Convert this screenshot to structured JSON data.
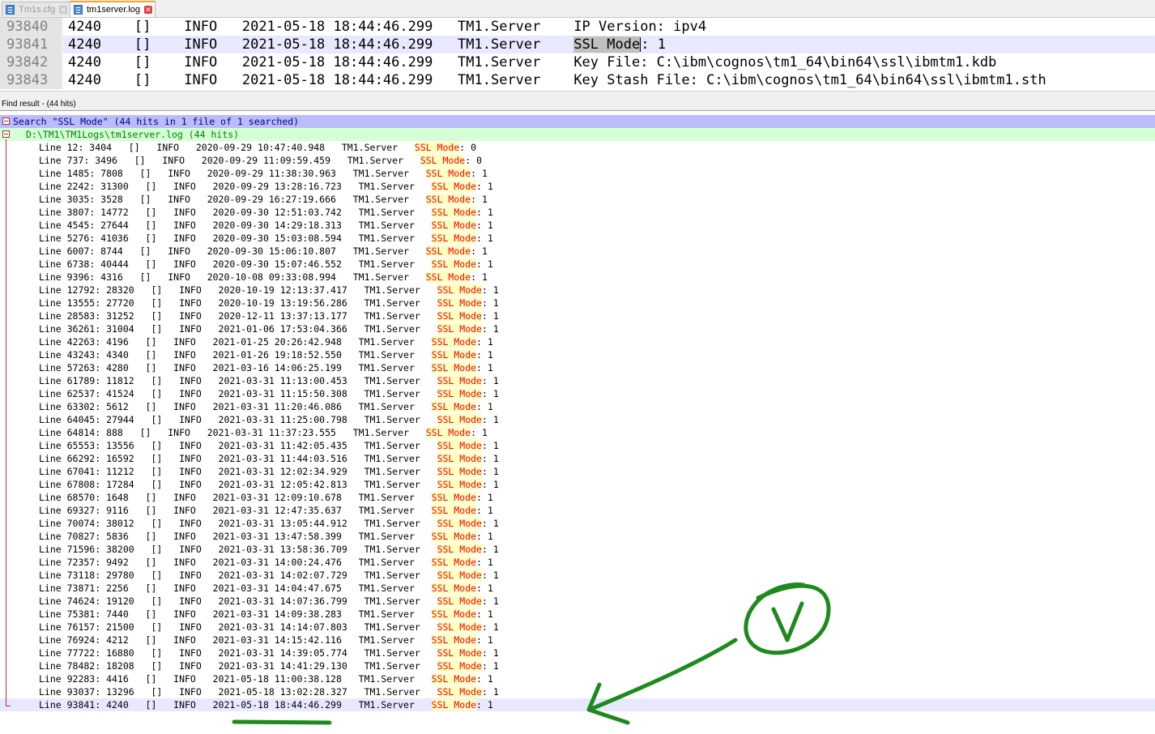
{
  "tabs": [
    {
      "label": "Tm1s.cfg",
      "active": false,
      "icon": "document-icon"
    },
    {
      "label": "tm1server.log",
      "active": true,
      "icon": "document-icon"
    }
  ],
  "editor": {
    "lines": [
      {
        "num": "93840",
        "pre": "4240    []    INFO   2021-05-18 18:44:46.299   TM1.Server    IP Version: ipv4",
        "match": "",
        "post": ""
      },
      {
        "num": "93841",
        "pre": "4240    []    INFO   2021-05-18 18:44:46.299   TM1.Server    ",
        "match": "SSL Mode",
        "post": ": 1"
      },
      {
        "num": "93842",
        "pre": "4240    []    INFO   2021-05-18 18:44:46.299   TM1.Server    Key File: C:\\ibm\\cognos\\tm1_64\\bin64\\ssl\\ibmtm1.kdb",
        "match": "",
        "post": ""
      },
      {
        "num": "93843",
        "pre": "4240    []    INFO   2021-05-18 18:44:46.299   TM1.Server    Key Stash File: C:\\ibm\\cognos\\tm1_64\\bin64\\ssl\\ibmtm1.sth",
        "match": "",
        "post": ""
      }
    ]
  },
  "find_panel": {
    "title": "Find result - (44 hits)",
    "search_header": "Search \"SSL Mode\" (44 hits in 1 file of 1 searched)",
    "file_header": "D:\\TM1\\TM1Logs\\tm1server.log (44 hits)",
    "results": [
      {
        "pre": "Line 12: 3404   []   INFO   2020-09-29 10:47:40.948   TM1.Server   ",
        "value": "0"
      },
      {
        "pre": "Line 737: 3496   []   INFO   2020-09-29 11:09:59.459   TM1.Server   ",
        "value": "0"
      },
      {
        "pre": "Line 1485: 7808   []   INFO   2020-09-29 11:38:30.963   TM1.Server   ",
        "value": "1"
      },
      {
        "pre": "Line 2242: 31300   []   INFO   2020-09-29 13:28:16.723   TM1.Server   ",
        "value": "1"
      },
      {
        "pre": "Line 3035: 3528   []   INFO   2020-09-29 16:27:19.666   TM1.Server   ",
        "value": "1"
      },
      {
        "pre": "Line 3807: 14772   []   INFO   2020-09-30 12:51:03.742   TM1.Server   ",
        "value": "1"
      },
      {
        "pre": "Line 4545: 27644   []   INFO   2020-09-30 14:29:18.313   TM1.Server   ",
        "value": "1"
      },
      {
        "pre": "Line 5276: 41036   []   INFO   2020-09-30 15:03:08.594   TM1.Server   ",
        "value": "1"
      },
      {
        "pre": "Line 6007: 8744   []   INFO   2020-09-30 15:06:10.807   TM1.Server   ",
        "value": "1"
      },
      {
        "pre": "Line 6738: 40444   []   INFO   2020-09-30 15:07:46.552   TM1.Server   ",
        "value": "1"
      },
      {
        "pre": "Line 9396: 4316   []   INFO   2020-10-08 09:33:08.994   TM1.Server   ",
        "value": "1"
      },
      {
        "pre": "Line 12792: 28320   []   INFO   2020-10-19 12:13:37.417   TM1.Server   ",
        "value": "1"
      },
      {
        "pre": "Line 13555: 27720   []   INFO   2020-10-19 13:19:56.286   TM1.Server   ",
        "value": "1"
      },
      {
        "pre": "Line 28583: 31252   []   INFO   2020-12-11 13:37:13.177   TM1.Server   ",
        "value": "1"
      },
      {
        "pre": "Line 36261: 31004   []   INFO   2021-01-06 17:53:04.366   TM1.Server   ",
        "value": "1"
      },
      {
        "pre": "Line 42263: 4196   []   INFO   2021-01-25 20:26:42.948   TM1.Server   ",
        "value": "1"
      },
      {
        "pre": "Line 43243: 4340   []   INFO   2021-01-26 19:18:52.550   TM1.Server   ",
        "value": "1"
      },
      {
        "pre": "Line 57263: 4280   []   INFO   2021-03-16 14:06:25.199   TM1.Server   ",
        "value": "1"
      },
      {
        "pre": "Line 61789: 11812   []   INFO   2021-03-31 11:13:00.453   TM1.Server   ",
        "value": "1"
      },
      {
        "pre": "Line 62537: 41524   []   INFO   2021-03-31 11:15:50.308   TM1.Server   ",
        "value": "1"
      },
      {
        "pre": "Line 63302: 5612   []   INFO   2021-03-31 11:20:46.086   TM1.Server   ",
        "value": "1"
      },
      {
        "pre": "Line 64045: 27944   []   INFO   2021-03-31 11:25:00.798   TM1.Server   ",
        "value": "1"
      },
      {
        "pre": "Line 64814: 888   []   INFO   2021-03-31 11:37:23.555   TM1.Server   ",
        "value": "1"
      },
      {
        "pre": "Line 65553: 13556   []   INFO   2021-03-31 11:42:05.435   TM1.Server   ",
        "value": "1"
      },
      {
        "pre": "Line 66292: 16592   []   INFO   2021-03-31 11:44:03.516   TM1.Server   ",
        "value": "1"
      },
      {
        "pre": "Line 67041: 11212   []   INFO   2021-03-31 12:02:34.929   TM1.Server   ",
        "value": "1"
      },
      {
        "pre": "Line 67808: 17284   []   INFO   2021-03-31 12:05:42.813   TM1.Server   ",
        "value": "1"
      },
      {
        "pre": "Line 68570: 1648   []   INFO   2021-03-31 12:09:10.678   TM1.Server   ",
        "value": "1"
      },
      {
        "pre": "Line 69327: 9116   []   INFO   2021-03-31 12:47:35.637   TM1.Server   ",
        "value": "1"
      },
      {
        "pre": "Line 70074: 38012   []   INFO   2021-03-31 13:05:44.912   TM1.Server   ",
        "value": "1"
      },
      {
        "pre": "Line 70827: 5836   []   INFO   2021-03-31 13:47:58.399   TM1.Server   ",
        "value": "1"
      },
      {
        "pre": "Line 71596: 38200   []   INFO   2021-03-31 13:58:36.709   TM1.Server   ",
        "value": "1"
      },
      {
        "pre": "Line 72357: 9492   []   INFO   2021-03-31 14:00:24.476   TM1.Server   ",
        "value": "1"
      },
      {
        "pre": "Line 73118: 29780   []   INFO   2021-03-31 14:02:07.729   TM1.Server   ",
        "value": "1"
      },
      {
        "pre": "Line 73871: 2256   []   INFO   2021-03-31 14:04:47.675   TM1.Server   ",
        "value": "1"
      },
      {
        "pre": "Line 74624: 19120   []   INFO   2021-03-31 14:07:36.799   TM1.Server   ",
        "value": "1"
      },
      {
        "pre": "Line 75381: 7440   []   INFO   2021-03-31 14:09:38.283   TM1.Server   ",
        "value": "1"
      },
      {
        "pre": "Line 76157: 21500   []   INFO   2021-03-31 14:14:07.803   TM1.Server   ",
        "value": "1"
      },
      {
        "pre": "Line 76924: 4212   []   INFO   2021-03-31 14:15:42.116   TM1.Server   ",
        "value": "1"
      },
      {
        "pre": "Line 77722: 16880   []   INFO   2021-03-31 14:39:05.774   TM1.Server   ",
        "value": "1"
      },
      {
        "pre": "Line 78482: 18208   []   INFO   2021-03-31 14:41:29.130   TM1.Server   ",
        "value": "1"
      },
      {
        "pre": "Line 92283: 4416   []   INFO   2021-05-18 11:00:38.128   TM1.Server   ",
        "value": "1"
      },
      {
        "pre": "Line 93037: 13296   []   INFO   2021-05-18 13:02:28.327   TM1.Server   ",
        "value": "1"
      },
      {
        "pre": "Line 93841: 4240   []   INFO   2021-05-18 18:44:46.299   TM1.Server   ",
        "value": "1"
      }
    ],
    "match_text": "SSL Mode",
    "highlighted_result_index": 43
  },
  "colors": {
    "search_header_bg": "#bbbbff",
    "file_header_bg": "#d5ffd5",
    "match_fg": "#ff0000",
    "match_bg": "#ffffc0",
    "annotation": "#1e8a1e"
  }
}
